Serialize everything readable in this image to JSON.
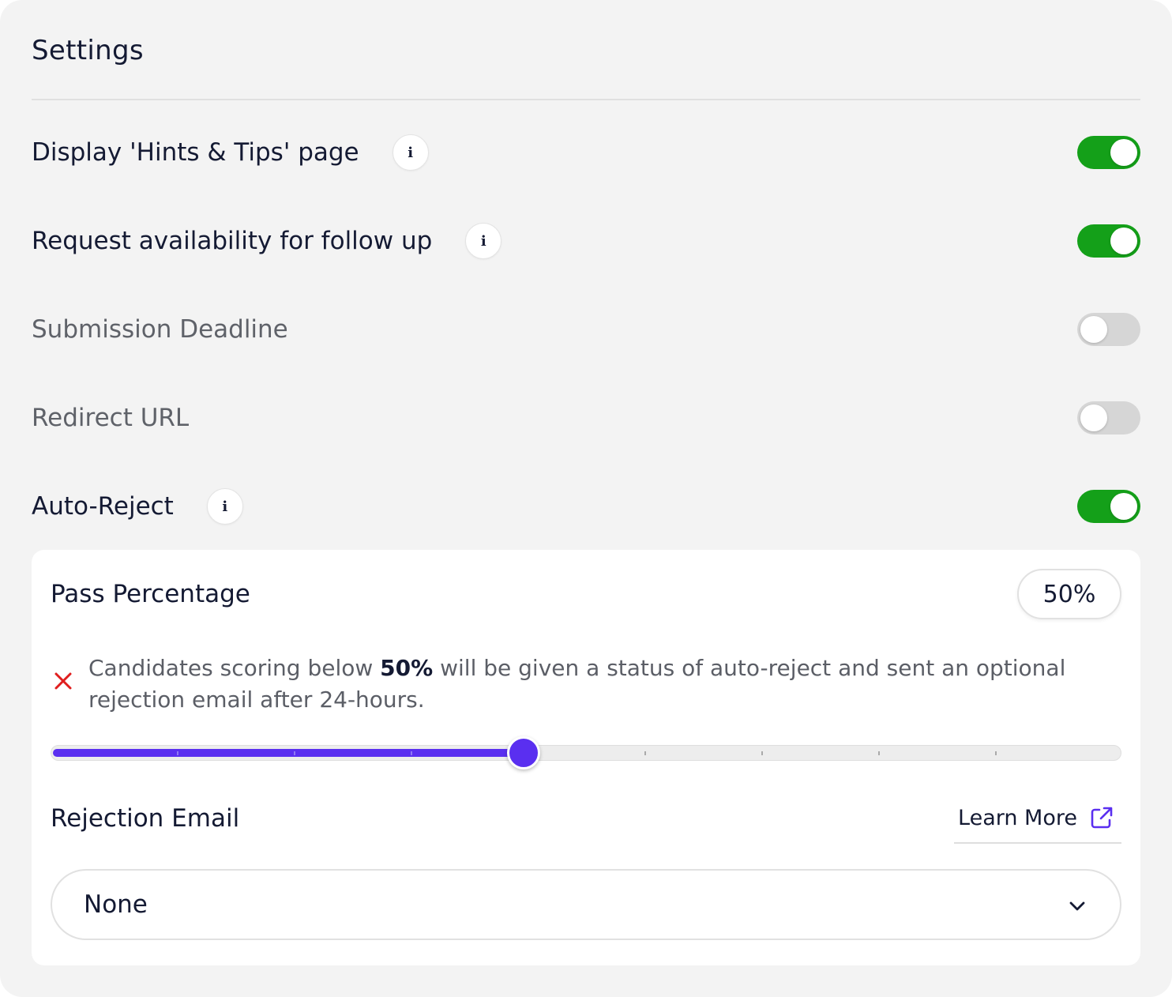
{
  "settings": {
    "title": "Settings",
    "rows": [
      {
        "label": "Display 'Hints & Tips' page",
        "info": "i",
        "enabled": true
      },
      {
        "label": "Request availability for follow up",
        "info": "i",
        "enabled": true
      },
      {
        "label": "Submission Deadline",
        "enabled": false
      },
      {
        "label": "Redirect URL",
        "enabled": false
      },
      {
        "label": "Auto-Reject",
        "info": "i",
        "enabled": true
      }
    ]
  },
  "auto_reject": {
    "pass_label": "Pass Percentage",
    "pass_value": "50%",
    "pass_fraction": 0.5,
    "notice_prefix": "Candidates scoring below ",
    "notice_value": "50%",
    "notice_suffix": " will be given a status of auto-reject and sent an optional rejection email after 24-hours.",
    "slider_ticks": 9,
    "rejection_label": "Rejection Email",
    "learn_more": "Learn More",
    "rejection_select_value": "None"
  },
  "colors": {
    "toggle_on": "#14a019",
    "toggle_off": "#d6d6d6",
    "accent": "#5a2ff0",
    "error_icon": "#e01e1e"
  },
  "icons": {
    "info": "info-icon",
    "reject": "close-icon",
    "external": "external-link-icon",
    "dropdown": "chevron-down-icon"
  }
}
